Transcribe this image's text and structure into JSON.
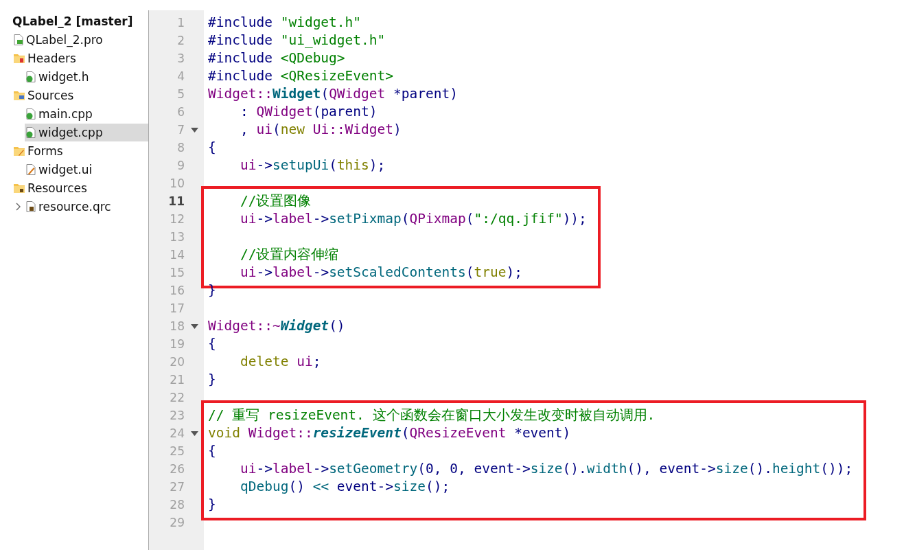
{
  "project_tree": {
    "title": "QLabel_2 [master]",
    "children": [
      {
        "label": "QLabel_2.pro",
        "kind": "project-file",
        "selected": false
      },
      {
        "label": "Headers",
        "kind": "header-folder",
        "selected": false,
        "children": [
          {
            "label": "widget.h",
            "kind": "header-file",
            "selected": false
          }
        ]
      },
      {
        "label": "Sources",
        "kind": "source-folder",
        "selected": false,
        "children": [
          {
            "label": "main.cpp",
            "kind": "source-file",
            "selected": false
          },
          {
            "label": "widget.cpp",
            "kind": "source-file",
            "selected": true
          }
        ]
      },
      {
        "label": "Forms",
        "kind": "form-folder",
        "selected": false,
        "children": [
          {
            "label": "widget.ui",
            "kind": "form-file",
            "selected": false
          }
        ]
      },
      {
        "label": "Resources",
        "kind": "resource-folder",
        "selected": false,
        "children": [
          {
            "label": "resource.qrc",
            "kind": "resource-file",
            "selected": false,
            "expanded": false
          }
        ]
      }
    ]
  },
  "editor": {
    "blocks": [
      {
        "annotated": false,
        "lines": [
          {
            "number": "1",
            "current": false,
            "fold_marker": false,
            "tokens": [
              {
                "kind": "preprocessor",
                "text": "#include "
              },
              {
                "kind": "string",
                "text": "\"widget.h\""
              }
            ]
          },
          {
            "number": "2",
            "current": false,
            "fold_marker": false,
            "tokens": [
              {
                "kind": "preprocessor",
                "text": "#include "
              },
              {
                "kind": "string",
                "text": "\"ui_widget.h\""
              }
            ]
          },
          {
            "number": "3",
            "current": false,
            "fold_marker": false,
            "tokens": [
              {
                "kind": "preprocessor",
                "text": "#include "
              },
              {
                "kind": "string",
                "text": "<QDebug>"
              }
            ]
          },
          {
            "number": "4",
            "current": false,
            "fold_marker": false,
            "tokens": [
              {
                "kind": "preprocessor",
                "text": "#include "
              },
              {
                "kind": "string",
                "text": "<QResizeEvent>"
              }
            ]
          },
          {
            "number": "5",
            "current": false,
            "fold_marker": false,
            "tokens": [
              {
                "kind": "type",
                "text": "Widget::"
              },
              {
                "kind": "definition",
                "text": "Widget"
              },
              {
                "kind": "plain",
                "text": "("
              },
              {
                "kind": "type",
                "text": "QWidget "
              },
              {
                "kind": "plain",
                "text": "*parent)"
              }
            ]
          },
          {
            "number": "6",
            "current": false,
            "fold_marker": false,
            "tokens": [
              {
                "kind": "plain",
                "text": "    : "
              },
              {
                "kind": "type",
                "text": "QWidget"
              },
              {
                "kind": "plain",
                "text": "(parent)"
              }
            ]
          },
          {
            "number": "7",
            "current": false,
            "fold_marker": true,
            "tokens": [
              {
                "kind": "plain",
                "text": "    , "
              },
              {
                "kind": "member",
                "text": "ui"
              },
              {
                "kind": "plain",
                "text": "("
              },
              {
                "kind": "keyword",
                "text": "new "
              },
              {
                "kind": "type",
                "text": "Ui::Widget"
              },
              {
                "kind": "plain",
                "text": ")"
              }
            ]
          },
          {
            "number": "8",
            "current": false,
            "fold_marker": false,
            "tokens": [
              {
                "kind": "plain",
                "text": "{"
              }
            ]
          },
          {
            "number": "9",
            "current": false,
            "fold_marker": false,
            "tokens": [
              {
                "kind": "member",
                "text": "    ui"
              },
              {
                "kind": "plain",
                "text": "->"
              },
              {
                "kind": "function",
                "text": "setupUi"
              },
              {
                "kind": "plain",
                "text": "("
              },
              {
                "kind": "keyword",
                "text": "this"
              },
              {
                "kind": "plain",
                "text": ");"
              }
            ]
          },
          {
            "number": "10",
            "current": false,
            "fold_marker": false
          }
        ]
      },
      {
        "annotated": true,
        "lines": [
          {
            "number": "11",
            "current": true,
            "fold_marker": false,
            "tokens": [
              {
                "kind": "comment",
                "text": "    //设置图像"
              }
            ]
          },
          {
            "number": "12",
            "current": false,
            "fold_marker": false,
            "tokens": [
              {
                "kind": "member",
                "text": "    ui"
              },
              {
                "kind": "plain",
                "text": "->"
              },
              {
                "kind": "member",
                "text": "label"
              },
              {
                "kind": "plain",
                "text": "->"
              },
              {
                "kind": "function",
                "text": "setPixmap"
              },
              {
                "kind": "plain",
                "text": "("
              },
              {
                "kind": "type",
                "text": "QPixmap"
              },
              {
                "kind": "plain",
                "text": "("
              },
              {
                "kind": "string",
                "text": "\":/qq.jfif\""
              },
              {
                "kind": "plain",
                "text": "));"
              }
            ]
          },
          {
            "number": "13",
            "current": false,
            "fold_marker": false
          },
          {
            "number": "14",
            "current": false,
            "fold_marker": false,
            "tokens": [
              {
                "kind": "comment",
                "text": "    //设置内容伸缩"
              }
            ]
          },
          {
            "number": "15",
            "current": false,
            "fold_marker": false,
            "tokens": [
              {
                "kind": "member",
                "text": "    ui"
              },
              {
                "kind": "plain",
                "text": "->"
              },
              {
                "kind": "member",
                "text": "label"
              },
              {
                "kind": "plain",
                "text": "->"
              },
              {
                "kind": "function",
                "text": "setScaledContents"
              },
              {
                "kind": "plain",
                "text": "("
              },
              {
                "kind": "keyword",
                "text": "true"
              },
              {
                "kind": "plain",
                "text": ");"
              }
            ]
          }
        ]
      },
      {
        "annotated": false,
        "lines": [
          {
            "number": "16",
            "current": false,
            "fold_marker": false,
            "tokens": [
              {
                "kind": "plain",
                "text": "}"
              }
            ]
          },
          {
            "number": "17",
            "current": false,
            "fold_marker": false
          },
          {
            "number": "18",
            "current": false,
            "fold_marker": true,
            "tokens": [
              {
                "kind": "type",
                "text": "Widget::~"
              },
              {
                "kind": "virtual_definition",
                "text": "Widget"
              },
              {
                "kind": "plain",
                "text": "()"
              }
            ]
          },
          {
            "number": "19",
            "current": false,
            "fold_marker": false,
            "tokens": [
              {
                "kind": "plain",
                "text": "{"
              }
            ]
          },
          {
            "number": "20",
            "current": false,
            "fold_marker": false,
            "tokens": [
              {
                "kind": "keyword",
                "text": "    delete "
              },
              {
                "kind": "member",
                "text": "ui"
              },
              {
                "kind": "plain",
                "text": ";"
              }
            ]
          },
          {
            "number": "21",
            "current": false,
            "fold_marker": false,
            "tokens": [
              {
                "kind": "plain",
                "text": "}"
              }
            ]
          },
          {
            "number": "22",
            "current": false,
            "fold_marker": false
          }
        ]
      },
      {
        "annotated": true,
        "lines": [
          {
            "number": "23",
            "current": false,
            "fold_marker": false,
            "tokens": [
              {
                "kind": "comment",
                "text": "// 重写 resizeEvent. 这个函数会在窗口大小发生改变时被自动调用."
              }
            ]
          },
          {
            "number": "24",
            "current": false,
            "fold_marker": true,
            "tokens": [
              {
                "kind": "keyword",
                "text": "void "
              },
              {
                "kind": "type",
                "text": "Widget::"
              },
              {
                "kind": "virtual_definition",
                "text": "resizeEvent"
              },
              {
                "kind": "plain",
                "text": "("
              },
              {
                "kind": "type",
                "text": "QResizeEvent "
              },
              {
                "kind": "plain",
                "text": "*event)"
              }
            ]
          },
          {
            "number": "25",
            "current": false,
            "fold_marker": false,
            "tokens": [
              {
                "kind": "plain",
                "text": "{"
              }
            ]
          },
          {
            "number": "26",
            "current": false,
            "fold_marker": false,
            "tokens": [
              {
                "kind": "member",
                "text": "    ui"
              },
              {
                "kind": "plain",
                "text": "->"
              },
              {
                "kind": "member",
                "text": "label"
              },
              {
                "kind": "plain",
                "text": "->"
              },
              {
                "kind": "function",
                "text": "setGeometry"
              },
              {
                "kind": "plain",
                "text": "(0, 0, event->"
              },
              {
                "kind": "function",
                "text": "size"
              },
              {
                "kind": "plain",
                "text": "()."
              },
              {
                "kind": "function",
                "text": "width"
              },
              {
                "kind": "plain",
                "text": "(), event->"
              },
              {
                "kind": "function",
                "text": "size"
              },
              {
                "kind": "plain",
                "text": "()."
              },
              {
                "kind": "function",
                "text": "height"
              },
              {
                "kind": "plain",
                "text": "());"
              }
            ]
          },
          {
            "number": "27",
            "current": false,
            "fold_marker": false,
            "tokens": [
              {
                "kind": "function",
                "text": "    qDebug"
              },
              {
                "kind": "plain",
                "text": "() "
              },
              {
                "kind": "function",
                "text": "<<"
              },
              {
                "kind": "plain",
                "text": " event->"
              },
              {
                "kind": "function",
                "text": "size"
              },
              {
                "kind": "plain",
                "text": "();"
              }
            ]
          },
          {
            "number": "28",
            "current": false,
            "fold_marker": false,
            "tokens": [
              {
                "kind": "plain",
                "text": "}"
              }
            ]
          }
        ]
      },
      {
        "annotated": false,
        "lines": [
          {
            "number": "29",
            "current": false,
            "fold_marker": false
          }
        ]
      }
    ]
  }
}
